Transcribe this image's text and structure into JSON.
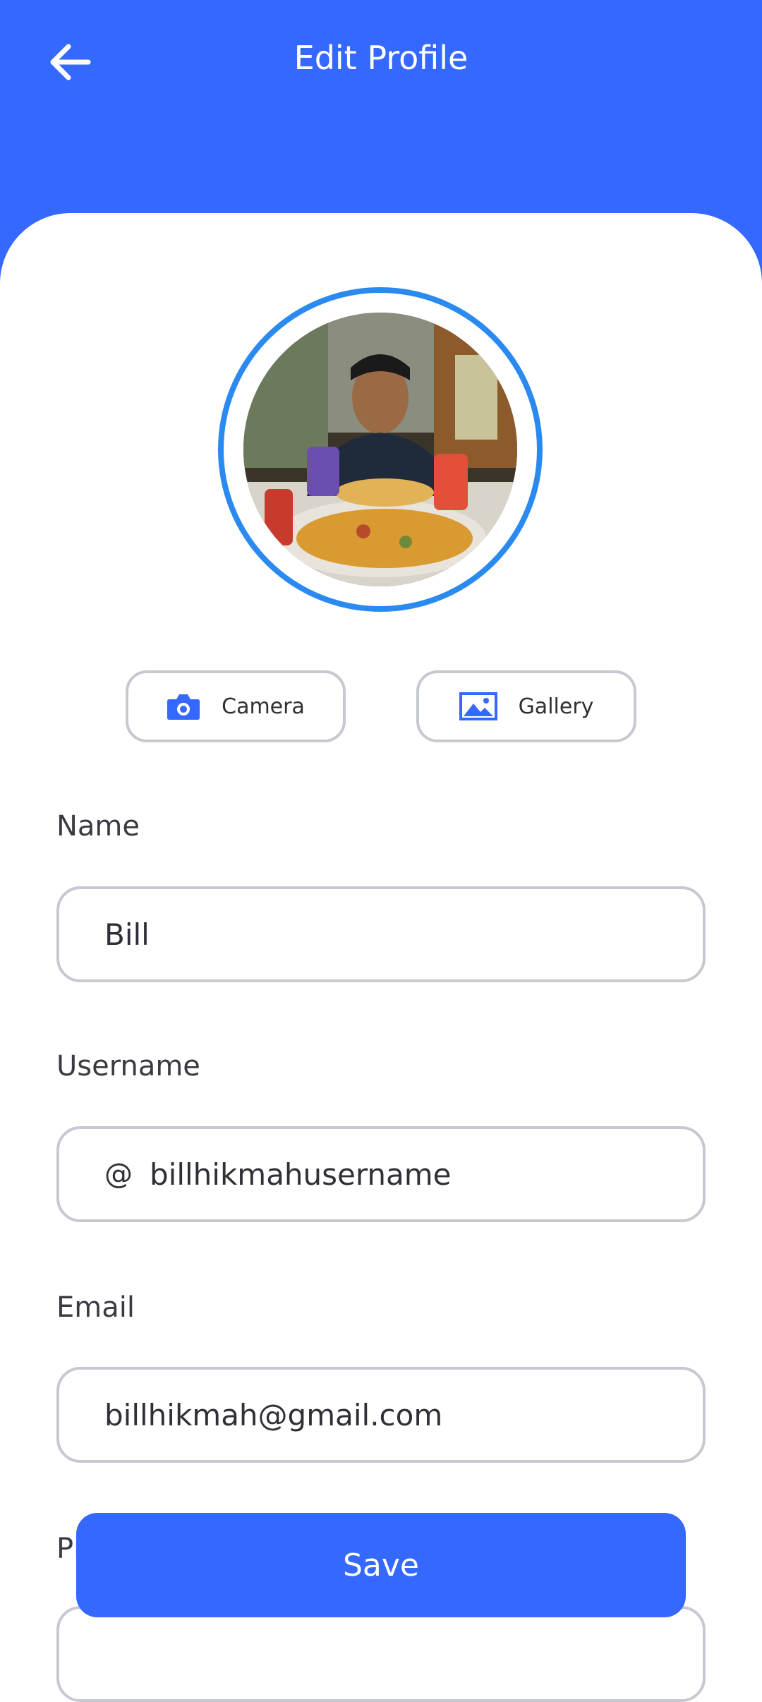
{
  "header": {
    "title": "Edit Profile",
    "back_icon": "arrow-left-icon",
    "background": "#3468ff"
  },
  "avatar": {
    "ring_color": "#2a8af0"
  },
  "photo_actions": {
    "camera_label": "Camera",
    "camera_icon": "camera-icon",
    "gallery_label": "Gallery",
    "gallery_icon": "image-icon"
  },
  "form": {
    "name": {
      "label": "Name",
      "value": "Bill"
    },
    "username": {
      "label": "Username",
      "prefix": "@",
      "value": "billhikmahusername"
    },
    "email": {
      "label": "Email",
      "value": "billhikmah@gmail.com"
    },
    "phone": {
      "label": "Pl"
    }
  },
  "save_label": "Save",
  "colors": {
    "accent": "#3468ff",
    "border": "#c7c9d2"
  }
}
